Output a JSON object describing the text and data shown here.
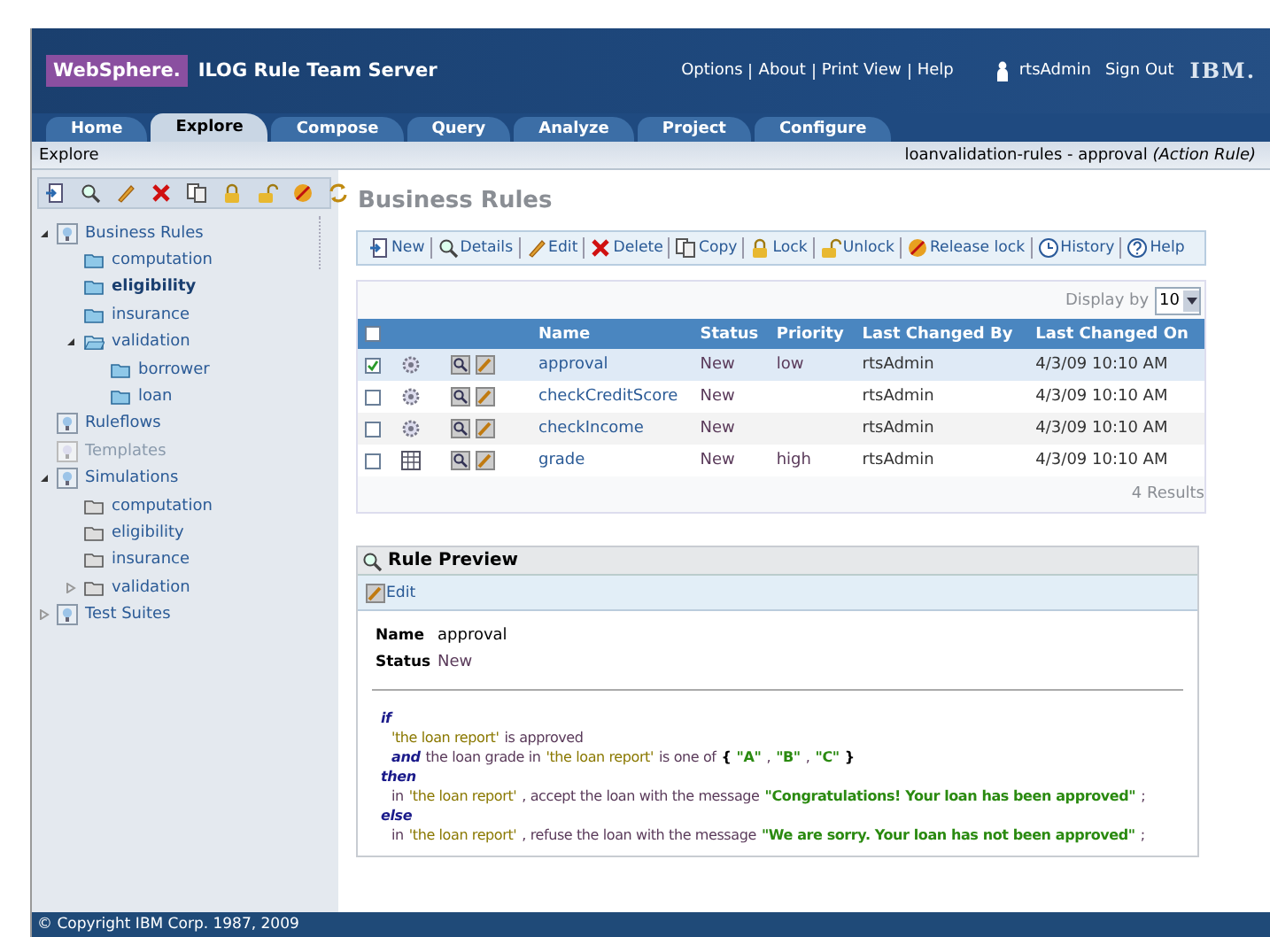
{
  "header": {
    "brand": "WebSphere.",
    "product": "ILOG Rule Team Server",
    "links": [
      "Options",
      "About",
      "Print View",
      "Help"
    ],
    "user": "rtsAdmin",
    "sign_out": "Sign Out",
    "logo": "IBM."
  },
  "tabs": [
    {
      "label": "Home",
      "selected": false
    },
    {
      "label": "Explore",
      "selected": true
    },
    {
      "label": "Compose",
      "selected": false
    },
    {
      "label": "Query",
      "selected": false
    },
    {
      "label": "Analyze",
      "selected": false
    },
    {
      "label": "Project",
      "selected": false
    },
    {
      "label": "Configure",
      "selected": false
    }
  ],
  "breadcrumb": {
    "left": "Explore",
    "right": "loanvalidation-rules - approval *(Action Rule)*"
  },
  "tree": [
    {
      "label": "Business Rules",
      "kind": "project",
      "expanded": true,
      "selected": false,
      "disabled": false,
      "children": [
        {
          "label": "computation",
          "kind": "rule-folder",
          "selected": false
        },
        {
          "label": "eligibility",
          "kind": "rule-folder",
          "selected": true
        },
        {
          "label": "insurance",
          "kind": "rule-folder",
          "selected": false
        },
        {
          "label": "validation",
          "kind": "rule-folder",
          "expanded": true,
          "selected": false,
          "children": [
            {
              "label": "borrower",
              "kind": "rule-folder",
              "selected": false
            },
            {
              "label": "loan",
              "kind": "rule-folder",
              "selected": false
            }
          ]
        }
      ]
    },
    {
      "label": "Ruleflows",
      "kind": "project",
      "selected": false,
      "disabled": false
    },
    {
      "label": "Templates",
      "kind": "project",
      "selected": false,
      "disabled": true
    },
    {
      "label": "Simulations",
      "kind": "project",
      "expanded": true,
      "selected": false,
      "disabled": false,
      "children": [
        {
          "label": "computation",
          "kind": "simulation-folder",
          "selected": false
        },
        {
          "label": "eligibility",
          "kind": "simulation-folder",
          "selected": false
        },
        {
          "label": "insurance",
          "kind": "simulation-folder",
          "selected": false
        },
        {
          "label": "validation",
          "kind": "simulation-folder",
          "expanded": false,
          "selected": false
        }
      ]
    },
    {
      "label": "Test Suites",
      "kind": "project",
      "expanded": false,
      "selected": false,
      "disabled": false
    }
  ],
  "page_title": "Business Rules",
  "toolbar": [
    "New",
    "Details",
    "Edit",
    "Delete",
    "Copy",
    "Lock",
    "Unlock",
    "Release lock",
    "History",
    "Help"
  ],
  "table": {
    "display_by_label": "Display by",
    "display_by": "10",
    "header_checked": false,
    "columns": [
      "Name",
      "Status",
      "Priority",
      "Last Changed By",
      "Last Changed On"
    ],
    "rows": [
      {
        "kind": "action",
        "checked": true,
        "selected": true,
        "name": "approval",
        "status": "New",
        "priority": "low",
        "changed_by": "rtsAdmin",
        "changed_on": "4/3/09 10:10 AM"
      },
      {
        "kind": "action",
        "checked": false,
        "selected": false,
        "name": "checkCreditScore",
        "status": "New",
        "changed_by": "rtsAdmin",
        "changed_on": "4/3/09 10:10 AM"
      },
      {
        "kind": "action",
        "checked": false,
        "selected": false,
        "name": "checkIncome",
        "status": "New",
        "changed_by": "rtsAdmin",
        "changed_on": "4/3/09 10:10 AM"
      },
      {
        "kind": "table",
        "checked": false,
        "selected": false,
        "name": "grade",
        "status": "New",
        "priority": "high",
        "changed_by": "rtsAdmin",
        "changed_on": "4/3/09 10:10 AM"
      }
    ],
    "results": "4 Results"
  },
  "preview": {
    "title": "Rule Preview",
    "edit": "Edit",
    "fields": [
      {
        "label": "Name",
        "value": "approval"
      },
      {
        "label": "Status",
        "value": "New"
      }
    ],
    "lines": [
      {
        "indent": false,
        "parts": [
          {
            "kind": "keyword",
            "text": "if"
          }
        ]
      },
      {
        "indent": true,
        "parts": [
          {
            "kind": "term",
            "text": "'the loan report'"
          },
          {
            "kind": "text",
            "text": "is approved"
          }
        ]
      },
      {
        "indent": true,
        "parts": [
          {
            "kind": "keyword",
            "text": "and"
          },
          {
            "kind": "text",
            "text": "the loan grade in"
          },
          {
            "kind": "term",
            "text": "'the loan report'"
          },
          {
            "kind": "text",
            "text": "is one of"
          },
          {
            "kind": "punct",
            "text": "{"
          },
          {
            "kind": "value",
            "text": "\"A\""
          },
          {
            "kind": "text",
            "text": ","
          },
          {
            "kind": "value",
            "text": "\"B\""
          },
          {
            "kind": "text",
            "text": ","
          },
          {
            "kind": "value",
            "text": "\"C\""
          },
          {
            "kind": "punct",
            "text": "}"
          }
        ]
      },
      {
        "indent": false,
        "parts": [
          {
            "kind": "keyword",
            "text": "then"
          }
        ]
      },
      {
        "indent": true,
        "parts": [
          {
            "kind": "text",
            "text": "in"
          },
          {
            "kind": "term",
            "text": "'the loan report'"
          },
          {
            "kind": "text",
            "text": ", accept the loan with the message"
          },
          {
            "kind": "value",
            "text": "\"Congratulations! Your loan has been approved\""
          },
          {
            "kind": "text",
            "text": ";"
          }
        ]
      },
      {
        "indent": false,
        "parts": [
          {
            "kind": "keyword",
            "text": "else"
          }
        ]
      },
      {
        "indent": true,
        "parts": [
          {
            "kind": "text",
            "text": "in"
          },
          {
            "kind": "term",
            "text": "'the loan report'"
          },
          {
            "kind": "text",
            "text": ", refuse the loan with the message"
          },
          {
            "kind": "value",
            "text": "\"We are sorry. Your loan has not been approved\""
          },
          {
            "kind": "text",
            "text": ";"
          }
        ]
      }
    ]
  },
  "footer": "© Copyright IBM Corp. 1987, 2009"
}
